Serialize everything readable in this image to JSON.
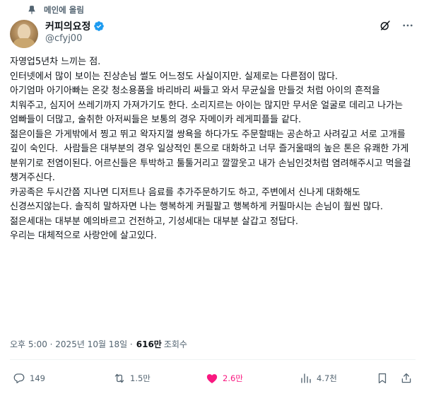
{
  "pinned": {
    "label": "메인에 올림"
  },
  "author": {
    "display_name": "커피의요정",
    "handle": "@cfyj00"
  },
  "post": {
    "paragraphs": [
      "자영업5년차 느끼는 점.",
      "인터넷에서 많이 보이는 진상손님 썰도 어느정도 사실이지만. 실제로는 다른점이 많다.",
      "아기엄마 아기아빠는 온갖 청소용품을 바리바리 싸들고 와서 무균실을 만들것 처럼 아이의 흔적을 치워주고, 심지어 쓰레기까지 가져가기도 한다. 소리지르는 아이는 많지만 무서운 얼굴로 데리고 나가는 엄빠들이 더많고, 술취한 아저씨들은 보통의 경우 자메이카 레게피플들 같다.",
      "젊은이들은 가게밖에서 찡고 뛰고 왁자지껄 쌍욕을 하다가도 주문할때는 공손하고 사려깊고 서로 고개를 깊이 숙인다.  사람들은 대부분의 경우 일상적인 톤으로 대화하고 너무 즐거울때의 높은 톤은 유쾌한 가게 분위기로 전염이된다. 어르신들은 투박하고 툴툴거리고 깔깔웃고 내가 손님인것처럼 염려해주시고 먹을걸 챙겨주신다.",
      "카공족은 두시간쯤 지나면 디저트나 음료를 추가주문하기도 하고, 주변에서 신나게 대화해도 신경쓰지않는다. 솔직히 말하자면 나는 행복하게 커필팔고 행복하게 커필마시는 손님이 훨씬 많다. 젊은세대는 대부분 예의바르고 건전하고, 기성세대는 대부분 살갑고 정답다.",
      "우리는 대체적으로 사랑안에 살고있다."
    ],
    "timestamp": "오후 5:00 · 2025년 10월 18일 ·",
    "views_count": "616만",
    "views_label": "조회수"
  },
  "actions": {
    "replies": "149",
    "reposts": "1.5만",
    "likes": "2.6만",
    "bookmarks": "4.7천"
  },
  "colors": {
    "text": "#0f1419",
    "muted": "#536471",
    "verified": "#1d9bf0",
    "like": "#f91880",
    "divider": "#eff3f4"
  },
  "icons": [
    "pin-icon",
    "verified-icon",
    "grok-icon",
    "more-icon",
    "reply-icon",
    "repost-icon",
    "like-icon",
    "views-icon",
    "bookmark-icon",
    "share-icon"
  ]
}
